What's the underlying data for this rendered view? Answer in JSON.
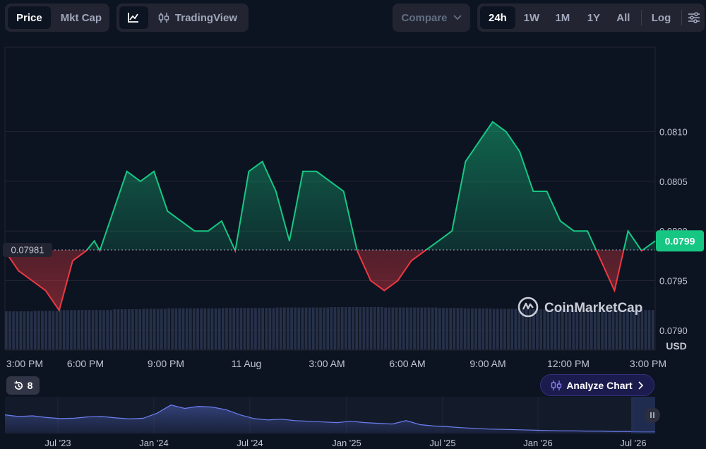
{
  "toolbar": {
    "view_tabs": [
      "Price",
      "Mkt Cap"
    ],
    "active_view": "Price",
    "tradingview_label": "TradingView",
    "compare_label": "Compare",
    "range_tabs": [
      "24h",
      "1W",
      "1M",
      "1Y",
      "All"
    ],
    "active_range": "24h",
    "log_label": "Log"
  },
  "chart": {
    "currency_label": "USD",
    "watermark": "CoinMarketCap",
    "baseline_label": "0.07981",
    "current_price_label": "0.0799",
    "y_ticks": [
      "0.0810",
      "0.0805",
      "0.0800",
      "0.0795",
      "0.0790"
    ],
    "x_ticks": [
      "3:00 PM",
      "6:00 PM",
      "9:00 PM",
      "11 Aug",
      "3:00 AM",
      "6:00 AM",
      "9:00 AM",
      "12:00 PM",
      "3:00 PM"
    ],
    "colors": {
      "up": "#16c784",
      "down": "#ea3943",
      "background": "#0d1421",
      "volume": "#2b3550"
    }
  },
  "chart_data": {
    "type": "area",
    "baseline": 0.07981,
    "current": 0.0799,
    "ylim": [
      0.0788,
      0.08185
    ],
    "y_ticks": [
      0.081,
      0.0805,
      0.08,
      0.0795,
      0.079
    ],
    "x_labels": [
      "3:00 PM",
      "6:00 PM",
      "9:00 PM",
      "11 Aug",
      "3:00 AM",
      "6:00 AM",
      "9:00 AM",
      "12:00 PM",
      "3:00 PM"
    ],
    "x": [
      0,
      0.5,
      1,
      1.5,
      2,
      2.5,
      3,
      3.3,
      3.5,
      4,
      4.5,
      5,
      5.5,
      6,
      6.5,
      7,
      7.5,
      8,
      8.5,
      9,
      9.5,
      10,
      10.5,
      11,
      11.5,
      12,
      12.5,
      13,
      13.5,
      14,
      14.5,
      15,
      15.5,
      16,
      16.5,
      17,
      17.5,
      18,
      18.5,
      19,
      19.5,
      20,
      20.5,
      21,
      21.5,
      22,
      22.5,
      23,
      23.5,
      24
    ],
    "series": [
      {
        "values": [
          0.0798,
          0.0796,
          0.0795,
          0.0794,
          0.0792,
          0.0797,
          0.0798,
          0.0799,
          0.0798,
          0.0802,
          0.0806,
          0.0805,
          0.0806,
          0.0802,
          0.0801,
          0.08,
          0.08,
          0.0801,
          0.0798,
          0.0806,
          0.0807,
          0.0804,
          0.0799,
          0.0806,
          0.0806,
          0.0805,
          0.0804,
          0.0798,
          0.0795,
          0.0794,
          0.0795,
          0.0797,
          0.0798,
          0.0799,
          0.08,
          0.0807,
          0.0809,
          0.0811,
          0.081,
          0.0808,
          0.0804,
          0.0804,
          0.0801,
          0.08,
          0.08,
          0.0797,
          0.0794,
          0.08,
          0.0798,
          0.0799
        ]
      }
    ],
    "volume_relative": [
      0.9,
      0.91,
      0.93,
      0.93,
      0.95,
      0.96,
      0.97,
      0.97,
      0.98,
      0.98,
      0.99,
      0.99,
      1.0,
      1.0,
      0.99,
      0.99,
      0.98,
      0.97,
      0.96,
      0.95,
      0.95,
      0.94,
      0.94,
      0.93
    ]
  },
  "overview": {
    "labels": [
      "Jul '23",
      "Jan '24",
      "Jul '24",
      "Jan '25",
      "Jul '25",
      "Jan '26",
      "Jul '26"
    ],
    "history_count": "8",
    "analyze_label": "Analyze Chart",
    "values": [
      0.55,
      0.5,
      0.52,
      0.47,
      0.44,
      0.45,
      0.49,
      0.5,
      0.46,
      0.43,
      0.45,
      0.6,
      0.84,
      0.74,
      0.8,
      0.78,
      0.7,
      0.55,
      0.44,
      0.4,
      0.42,
      0.38,
      0.36,
      0.34,
      0.32,
      0.36,
      0.32,
      0.3,
      0.28,
      0.38,
      0.26,
      0.22,
      0.2,
      0.17,
      0.15,
      0.13,
      0.12,
      0.11,
      0.1,
      0.09,
      0.08,
      0.08,
      0.07,
      0.07,
      0.06,
      0.06,
      0.05,
      0.05
    ]
  }
}
